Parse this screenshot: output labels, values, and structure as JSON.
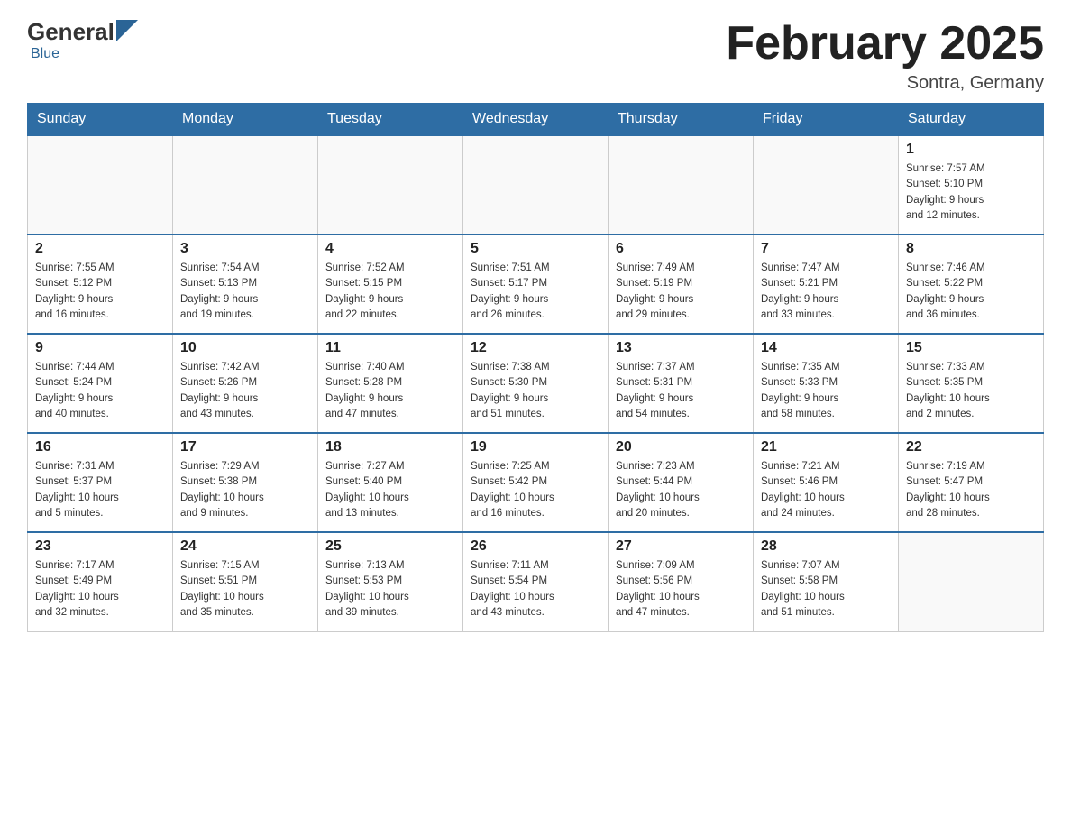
{
  "header": {
    "logo_general": "General",
    "logo_blue": "Blue",
    "month_title": "February 2025",
    "location": "Sontra, Germany"
  },
  "days_of_week": [
    "Sunday",
    "Monday",
    "Tuesday",
    "Wednesday",
    "Thursday",
    "Friday",
    "Saturday"
  ],
  "weeks": [
    [
      {
        "day": "",
        "info": ""
      },
      {
        "day": "",
        "info": ""
      },
      {
        "day": "",
        "info": ""
      },
      {
        "day": "",
        "info": ""
      },
      {
        "day": "",
        "info": ""
      },
      {
        "day": "",
        "info": ""
      },
      {
        "day": "1",
        "info": "Sunrise: 7:57 AM\nSunset: 5:10 PM\nDaylight: 9 hours\nand 12 minutes."
      }
    ],
    [
      {
        "day": "2",
        "info": "Sunrise: 7:55 AM\nSunset: 5:12 PM\nDaylight: 9 hours\nand 16 minutes."
      },
      {
        "day": "3",
        "info": "Sunrise: 7:54 AM\nSunset: 5:13 PM\nDaylight: 9 hours\nand 19 minutes."
      },
      {
        "day": "4",
        "info": "Sunrise: 7:52 AM\nSunset: 5:15 PM\nDaylight: 9 hours\nand 22 minutes."
      },
      {
        "day": "5",
        "info": "Sunrise: 7:51 AM\nSunset: 5:17 PM\nDaylight: 9 hours\nand 26 minutes."
      },
      {
        "day": "6",
        "info": "Sunrise: 7:49 AM\nSunset: 5:19 PM\nDaylight: 9 hours\nand 29 minutes."
      },
      {
        "day": "7",
        "info": "Sunrise: 7:47 AM\nSunset: 5:21 PM\nDaylight: 9 hours\nand 33 minutes."
      },
      {
        "day": "8",
        "info": "Sunrise: 7:46 AM\nSunset: 5:22 PM\nDaylight: 9 hours\nand 36 minutes."
      }
    ],
    [
      {
        "day": "9",
        "info": "Sunrise: 7:44 AM\nSunset: 5:24 PM\nDaylight: 9 hours\nand 40 minutes."
      },
      {
        "day": "10",
        "info": "Sunrise: 7:42 AM\nSunset: 5:26 PM\nDaylight: 9 hours\nand 43 minutes."
      },
      {
        "day": "11",
        "info": "Sunrise: 7:40 AM\nSunset: 5:28 PM\nDaylight: 9 hours\nand 47 minutes."
      },
      {
        "day": "12",
        "info": "Sunrise: 7:38 AM\nSunset: 5:30 PM\nDaylight: 9 hours\nand 51 minutes."
      },
      {
        "day": "13",
        "info": "Sunrise: 7:37 AM\nSunset: 5:31 PM\nDaylight: 9 hours\nand 54 minutes."
      },
      {
        "day": "14",
        "info": "Sunrise: 7:35 AM\nSunset: 5:33 PM\nDaylight: 9 hours\nand 58 minutes."
      },
      {
        "day": "15",
        "info": "Sunrise: 7:33 AM\nSunset: 5:35 PM\nDaylight: 10 hours\nand 2 minutes."
      }
    ],
    [
      {
        "day": "16",
        "info": "Sunrise: 7:31 AM\nSunset: 5:37 PM\nDaylight: 10 hours\nand 5 minutes."
      },
      {
        "day": "17",
        "info": "Sunrise: 7:29 AM\nSunset: 5:38 PM\nDaylight: 10 hours\nand 9 minutes."
      },
      {
        "day": "18",
        "info": "Sunrise: 7:27 AM\nSunset: 5:40 PM\nDaylight: 10 hours\nand 13 minutes."
      },
      {
        "day": "19",
        "info": "Sunrise: 7:25 AM\nSunset: 5:42 PM\nDaylight: 10 hours\nand 16 minutes."
      },
      {
        "day": "20",
        "info": "Sunrise: 7:23 AM\nSunset: 5:44 PM\nDaylight: 10 hours\nand 20 minutes."
      },
      {
        "day": "21",
        "info": "Sunrise: 7:21 AM\nSunset: 5:46 PM\nDaylight: 10 hours\nand 24 minutes."
      },
      {
        "day": "22",
        "info": "Sunrise: 7:19 AM\nSunset: 5:47 PM\nDaylight: 10 hours\nand 28 minutes."
      }
    ],
    [
      {
        "day": "23",
        "info": "Sunrise: 7:17 AM\nSunset: 5:49 PM\nDaylight: 10 hours\nand 32 minutes."
      },
      {
        "day": "24",
        "info": "Sunrise: 7:15 AM\nSunset: 5:51 PM\nDaylight: 10 hours\nand 35 minutes."
      },
      {
        "day": "25",
        "info": "Sunrise: 7:13 AM\nSunset: 5:53 PM\nDaylight: 10 hours\nand 39 minutes."
      },
      {
        "day": "26",
        "info": "Sunrise: 7:11 AM\nSunset: 5:54 PM\nDaylight: 10 hours\nand 43 minutes."
      },
      {
        "day": "27",
        "info": "Sunrise: 7:09 AM\nSunset: 5:56 PM\nDaylight: 10 hours\nand 47 minutes."
      },
      {
        "day": "28",
        "info": "Sunrise: 7:07 AM\nSunset: 5:58 PM\nDaylight: 10 hours\nand 51 minutes."
      },
      {
        "day": "",
        "info": ""
      }
    ]
  ]
}
